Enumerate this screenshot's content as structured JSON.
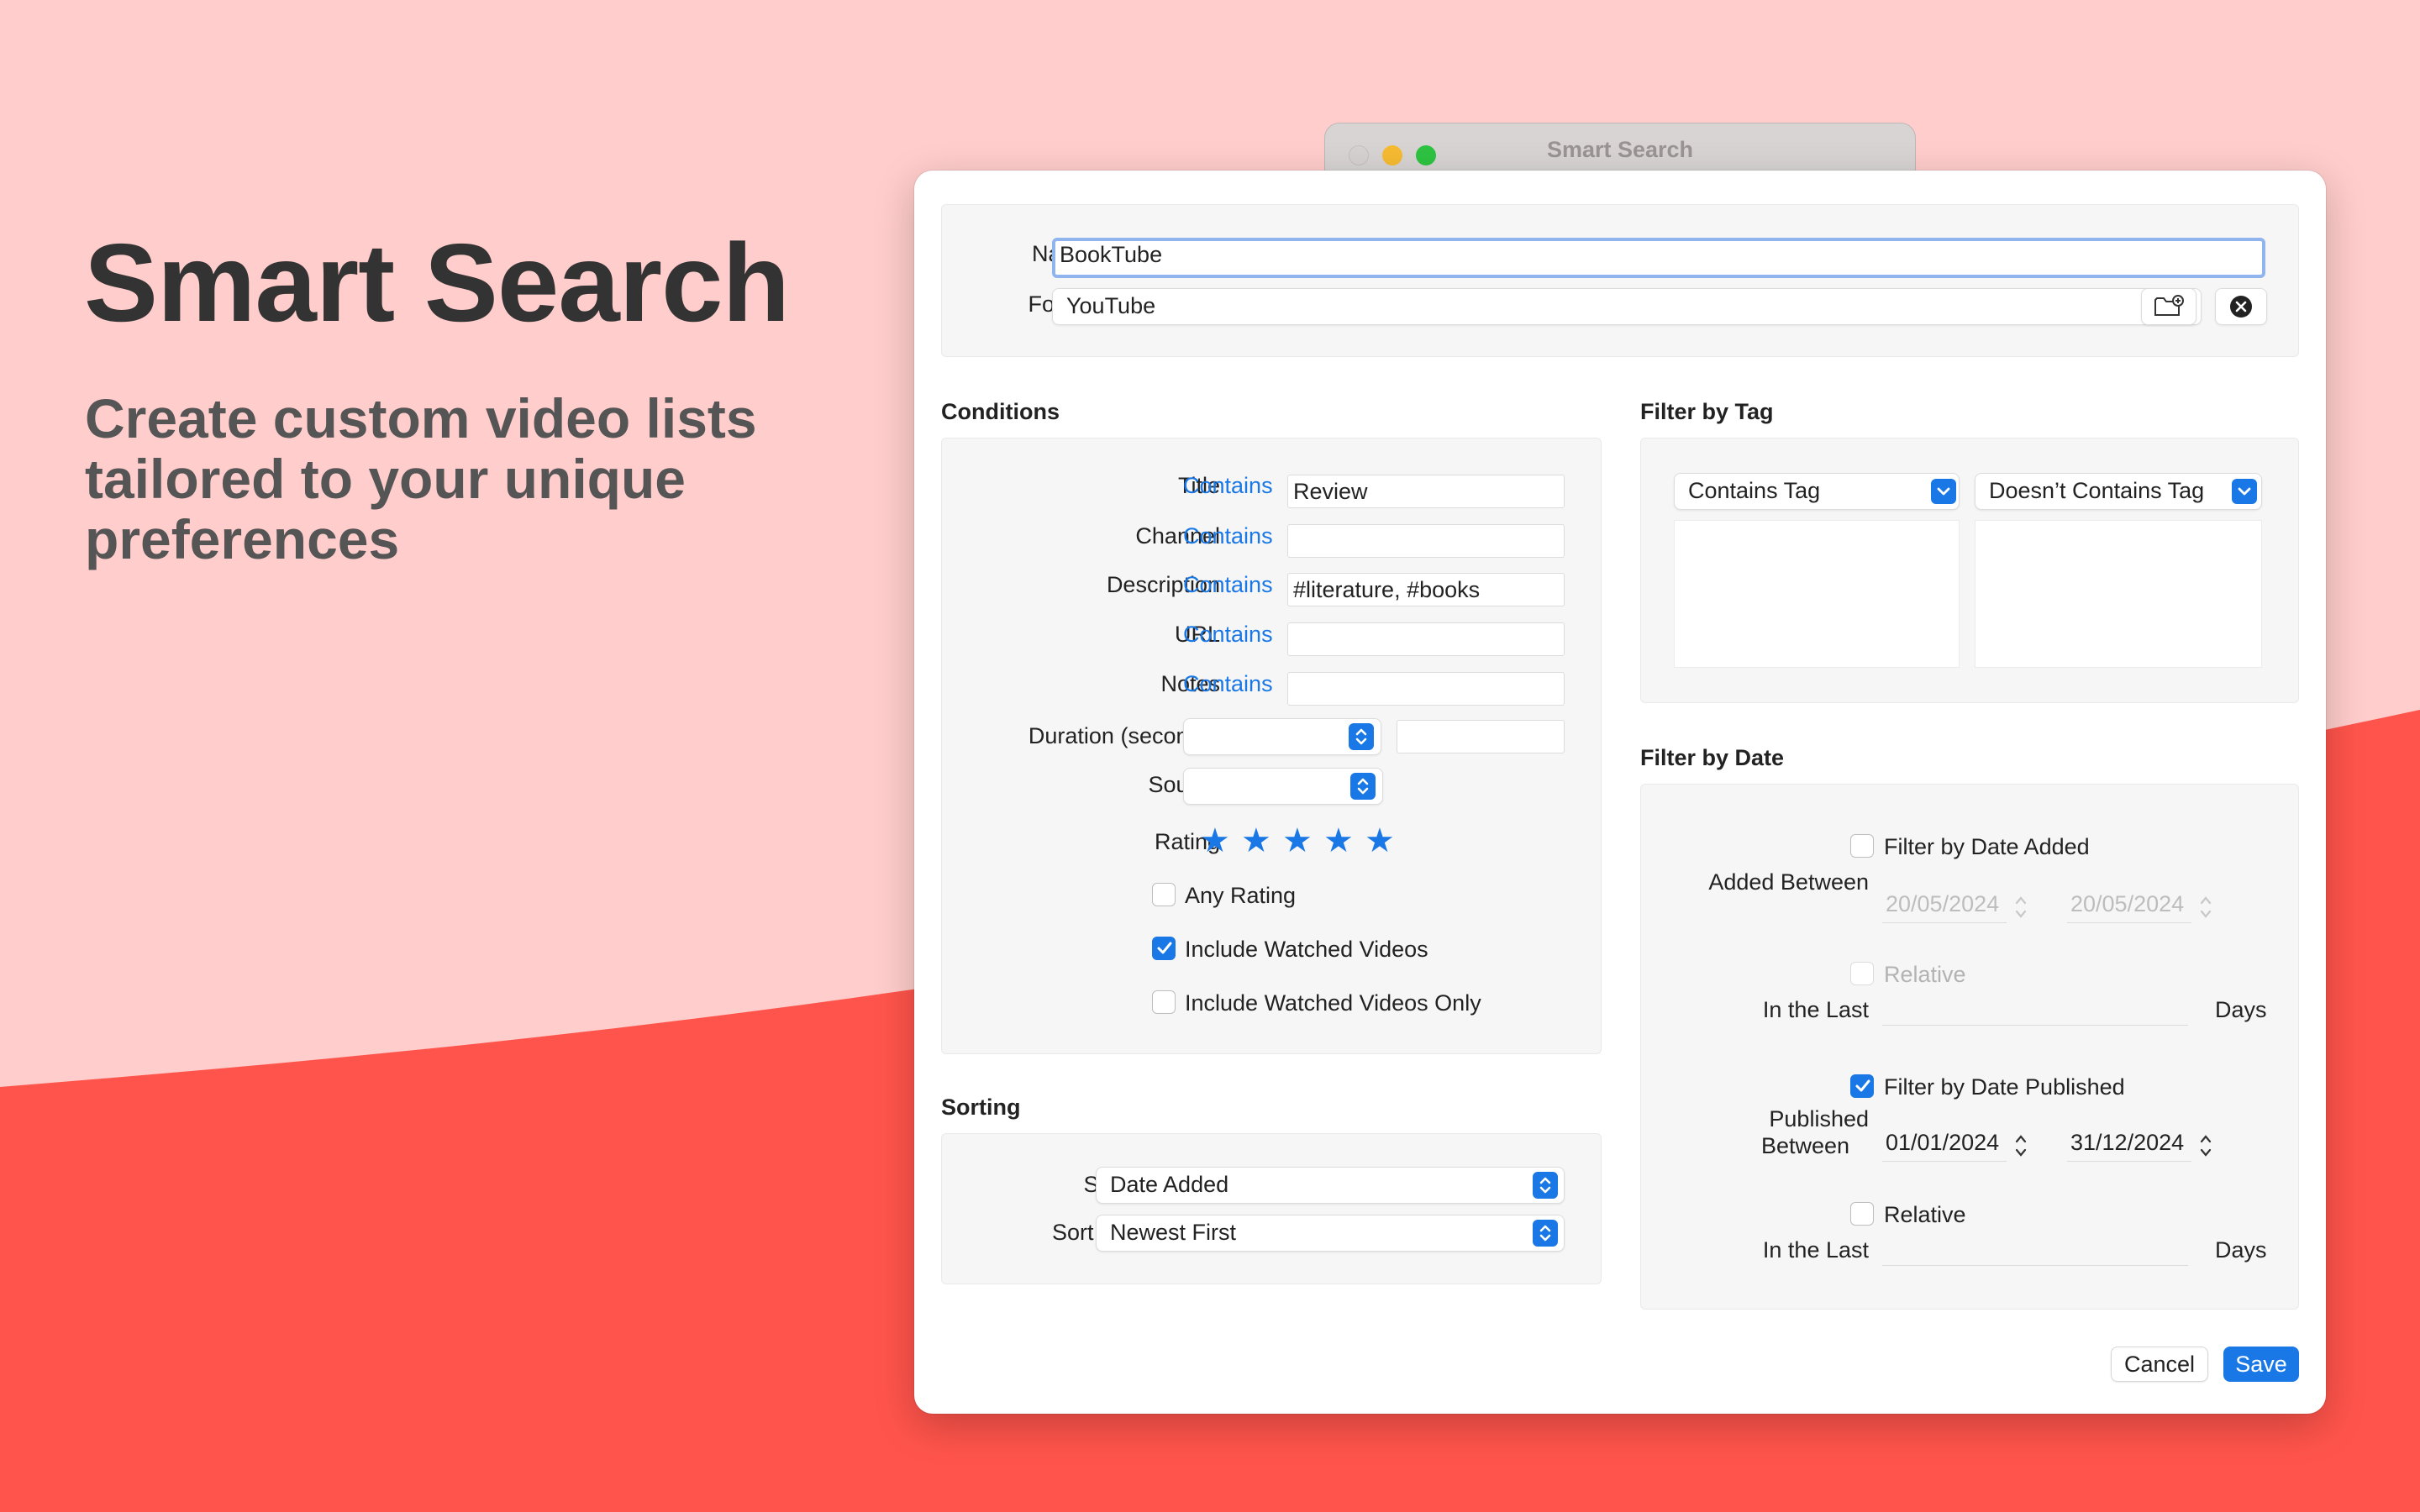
{
  "hero": {
    "title": "Smart Search",
    "subtitle": "Create custom video lists tailored to your unique preferences"
  },
  "colors": {
    "accent": "#1a78e6",
    "background_light": "#ffcdcb",
    "background_dark": "#ff544b"
  },
  "back_window": {
    "title": "Smart Search"
  },
  "dialog": {
    "name_label": "Name",
    "name_value": "BookTube",
    "folder_label": "Folder",
    "folder_value": "YouTube",
    "conditions": {
      "header": "Conditions",
      "rows": [
        {
          "label": "Title",
          "operator": "Contains",
          "value": "Review"
        },
        {
          "label": "Channel",
          "operator": "Contains",
          "value": ""
        },
        {
          "label": "Description",
          "operator": "Contains",
          "value": "#literature, #books"
        },
        {
          "label": "URL",
          "operator": "Contains",
          "value": ""
        },
        {
          "label": "Notes",
          "operator": "Contains",
          "value": ""
        }
      ],
      "duration_label": "Duration (seconds)",
      "source_label": "Source",
      "rating_label": "Rating",
      "rating_stars": 5,
      "any_rating": "Any Rating",
      "any_rating_checked": false,
      "include_watched": "Include Watched Videos",
      "include_watched_checked": true,
      "include_watched_only": "Include Watched Videos Only",
      "include_watched_only_checked": false
    },
    "sorting": {
      "header": "Sorting",
      "sort_by_label": "Sort By",
      "sort_by_value": "Date Added",
      "sort_order_label": "Sort Order",
      "sort_order_value": "Newest First"
    },
    "filter_by_tag": {
      "header": "Filter by Tag",
      "contains_tag": "Contains Tag",
      "doesnt_contain_tag": "Doesn’t Contains Tag"
    },
    "filter_by_date": {
      "header": "Filter by Date",
      "filter_added": "Filter by Date Added",
      "filter_added_checked": false,
      "added_between": "Added Between",
      "added_from": "20/05/2024",
      "added_to": "20/05/2024",
      "relative": "Relative",
      "in_the_last": "In the Last",
      "days": "Days",
      "filter_published": "Filter by Date Published",
      "filter_published_checked": true,
      "published_between_line1": "Published",
      "published_between_line2": "Between",
      "published_from": "01/01/2024",
      "published_to": "31/12/2024",
      "relative_published_checked": false
    },
    "buttons": {
      "cancel": "Cancel",
      "save": "Save"
    }
  }
}
